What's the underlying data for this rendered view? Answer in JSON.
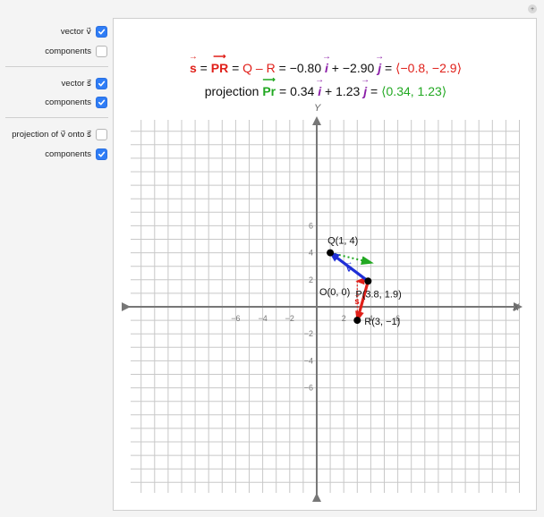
{
  "controls": [
    {
      "label": "vector v⃗",
      "checked": true
    },
    {
      "label": "components",
      "checked": false
    },
    {
      "label": "vector s⃗",
      "checked": true
    },
    {
      "label": "components",
      "checked": true
    },
    {
      "label": "projection of v⃗ onto s⃗",
      "checked": false
    },
    {
      "label": "components",
      "checked": true
    }
  ],
  "formula1": {
    "s": "s",
    "eq1": " = ",
    "pr": "PR",
    "eq2": " = ",
    "q_minus_r": "Q – R",
    "eq3": " = −0.80 ",
    "i": "i",
    "plus": " + −2.90 ",
    "j": "j",
    "eq4": " = ",
    "tuple": "⟨−0.8, −2.9⟩"
  },
  "formula2": {
    "prefix": "projection ",
    "pr": "Pr",
    "eq1": " = 0.34 ",
    "i": "i",
    "plus": " + 1.23 ",
    "j": "j",
    "eq2": " = ",
    "tuple": "⟨0.34, 1.23⟩"
  },
  "axes": {
    "x_label": "X",
    "y_label": "Y",
    "x_ticks": [
      "−6",
      "−4",
      "−2",
      "2",
      "4",
      "6"
    ],
    "y_ticks": [
      "6",
      "4",
      "2",
      "−2",
      "−4",
      "−6"
    ]
  },
  "points": {
    "Q": "Q(1, 4)",
    "P": "P(3.8, 1.9)",
    "R": "R(3, −1)",
    "O": "O(0, 0)"
  },
  "vector_labels": {
    "v": "v",
    "s": "s"
  },
  "colors": {
    "vector_v": "#1f2fd6",
    "vector_s": "#e0201a",
    "projection": "#22a822",
    "checkbox": "#2f7df6"
  }
}
